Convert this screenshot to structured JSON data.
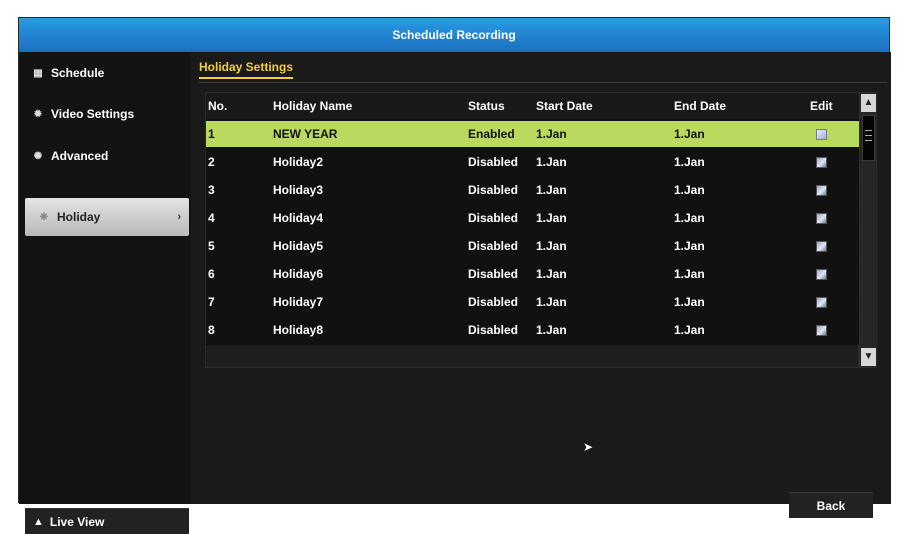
{
  "window": {
    "title": "Scheduled Recording"
  },
  "sidebar": {
    "items": [
      {
        "label": "Schedule",
        "icon": "calendar-icon"
      },
      {
        "label": "Video Settings",
        "icon": "gear-icon"
      },
      {
        "label": "Advanced",
        "icon": "gears-icon"
      },
      {
        "label": "Holiday",
        "icon": "holiday-icon",
        "active": true
      }
    ],
    "live_view": "Live View"
  },
  "main": {
    "tab": "Holiday Settings",
    "columns": [
      "No.",
      "Holiday Name",
      "Status",
      "Start Date",
      "End Date",
      "Edit"
    ],
    "rows": [
      {
        "no": "1",
        "name": "NEW YEAR",
        "status": "Enabled",
        "start": "1.Jan",
        "end": "1.Jan",
        "selected": true
      },
      {
        "no": "2",
        "name": "Holiday2",
        "status": "Disabled",
        "start": "1.Jan",
        "end": "1.Jan"
      },
      {
        "no": "3",
        "name": "Holiday3",
        "status": "Disabled",
        "start": "1.Jan",
        "end": "1.Jan"
      },
      {
        "no": "4",
        "name": "Holiday4",
        "status": "Disabled",
        "start": "1.Jan",
        "end": "1.Jan"
      },
      {
        "no": "5",
        "name": "Holiday5",
        "status": "Disabled",
        "start": "1.Jan",
        "end": "1.Jan"
      },
      {
        "no": "6",
        "name": "Holiday6",
        "status": "Disabled",
        "start": "1.Jan",
        "end": "1.Jan"
      },
      {
        "no": "7",
        "name": "Holiday7",
        "status": "Disabled",
        "start": "1.Jan",
        "end": "1.Jan"
      },
      {
        "no": "8",
        "name": "Holiday8",
        "status": "Disabled",
        "start": "1.Jan",
        "end": "1.Jan"
      }
    ],
    "back_label": "Back"
  },
  "colors": {
    "title_bar": "#1f86d6",
    "selected_row": "#b9d95f",
    "tab_accent": "#f2cf3a"
  }
}
